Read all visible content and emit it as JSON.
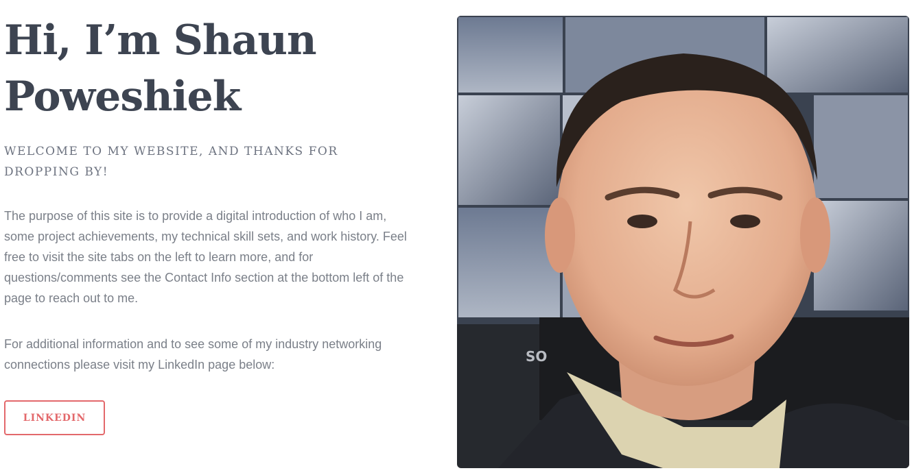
{
  "hero": {
    "title_line1": "Hi, I’m Shaun",
    "title_line2": "Poweshiek",
    "tagline": "WELCOME TO MY WEBSITE, AND THANKS FOR DROPPING BY!"
  },
  "intro": {
    "paragraph1": "The purpose of this site is to provide a digital introduction of who I am, some project achievements, my technical skill sets, and work history. Feel free to visit the site tabs on the left to learn more, and for questions/comments see the Contact Info section at the bottom left of the page to reach out to me.",
    "paragraph2": "For additional information and to see some of my industry networking connections please visit my LinkedIn page below:"
  },
  "linkedin_button": {
    "label": "LINKEDIN"
  },
  "photo": {
    "monitor_brand": "SO",
    "colors": {
      "accent": "#e3686b",
      "heading": "#3d4451",
      "body_text": "#7a7f88"
    }
  }
}
